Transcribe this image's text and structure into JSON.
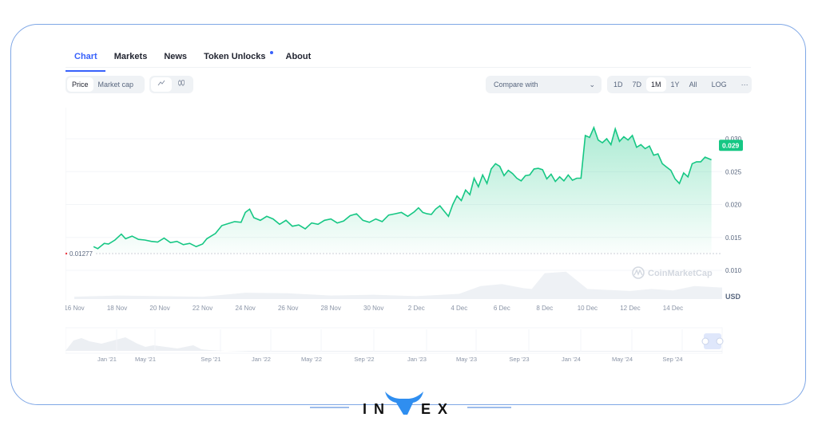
{
  "tabs": [
    {
      "label": "Chart",
      "active": true
    },
    {
      "label": "Markets",
      "active": false
    },
    {
      "label": "News",
      "active": false
    },
    {
      "label": "Token Unlocks",
      "active": false,
      "badge": true
    },
    {
      "label": "About",
      "active": false
    }
  ],
  "toolbar": {
    "price_label": "Price",
    "marketcap_label": "Market cap",
    "line_icon": "line-chart-icon",
    "candle_icon": "candlestick-icon",
    "compare_label": "Compare with",
    "ranges": [
      "1D",
      "7D",
      "1M",
      "1Y",
      "All"
    ],
    "active_range": "1M",
    "log_label": "LOG",
    "more_label": "···"
  },
  "colors": {
    "accent": "#3861fb",
    "line": "#16c784",
    "volume": "#eef1f5",
    "frame": "#7fa7e6"
  },
  "chart_data": {
    "type": "area",
    "title": "",
    "xlabel": "",
    "ylabel": "USD",
    "currency": "USD",
    "current_price_label": "0.029",
    "start_price_label": "0.01277",
    "ylim": [
      0.0085,
      0.0325
    ],
    "y_ticks": [
      "0.030",
      "0.025",
      "0.020",
      "0.015",
      "0.010"
    ],
    "y_tick_values": [
      0.03,
      0.025,
      0.02,
      0.015,
      0.01
    ],
    "x_range_days": [
      0,
      30.3
    ],
    "x_ticks": [
      "16 Nov",
      "18 Nov",
      "20 Nov",
      "22 Nov",
      "24 Nov",
      "26 Nov",
      "28 Nov",
      "30 Nov",
      "2 Dec",
      "4 Dec",
      "6 Dec",
      "8 Dec",
      "10 Dec",
      "12 Dec",
      "14 Dec"
    ],
    "x_tick_days": [
      0,
      2,
      4,
      6,
      8,
      10,
      12,
      14,
      16,
      18,
      20,
      22,
      24,
      26,
      28
    ],
    "watermark": "CoinMarketCap",
    "series": [
      {
        "name": "Price",
        "x_days": [
          0.9,
          1.1,
          1.4,
          1.6,
          1.9,
          2.2,
          2.4,
          2.7,
          3.0,
          3.3,
          3.6,
          3.9,
          4.2,
          4.5,
          4.8,
          5.1,
          5.4,
          5.7,
          6.0,
          6.2,
          6.4,
          6.6,
          6.9,
          7.2,
          7.5,
          7.8,
          8.0,
          8.2,
          8.4,
          8.7,
          9.0,
          9.3,
          9.6,
          9.9,
          10.2,
          10.5,
          10.8,
          11.1,
          11.4,
          11.7,
          12.0,
          12.3,
          12.6,
          12.9,
          13.2,
          13.5,
          13.8,
          14.1,
          14.4,
          14.7,
          15.0,
          15.3,
          15.6,
          15.9,
          16.1,
          16.3,
          16.5,
          16.7,
          16.9,
          17.1,
          17.3,
          17.5,
          17.7,
          17.9,
          18.1,
          18.3,
          18.5,
          18.7,
          18.9,
          19.1,
          19.3,
          19.5,
          19.7,
          19.9,
          20.1,
          20.3,
          20.5,
          20.7,
          20.9,
          21.1,
          21.3,
          21.5,
          21.7,
          21.9,
          22.1,
          22.3,
          22.5,
          22.7,
          22.9,
          23.1,
          23.3,
          23.5,
          23.7,
          23.9,
          24.1,
          24.3,
          24.5,
          24.7,
          24.9,
          25.1,
          25.3,
          25.5,
          25.7,
          25.9,
          26.1,
          26.3,
          26.5,
          26.7,
          26.9,
          27.1,
          27.3,
          27.5,
          27.7,
          27.9,
          28.1,
          28.3,
          28.5,
          28.7,
          28.9,
          29.1,
          29.3,
          29.5,
          29.8
        ],
        "values": [
          0.0136,
          0.0133,
          0.0141,
          0.014,
          0.0146,
          0.0155,
          0.0148,
          0.0152,
          0.0147,
          0.0146,
          0.0144,
          0.0143,
          0.0149,
          0.0142,
          0.0144,
          0.0139,
          0.0141,
          0.0136,
          0.014,
          0.0148,
          0.0152,
          0.0156,
          0.0168,
          0.0171,
          0.0174,
          0.0173,
          0.0188,
          0.0193,
          0.018,
          0.0176,
          0.0182,
          0.0178,
          0.017,
          0.0176,
          0.0167,
          0.0169,
          0.0163,
          0.0172,
          0.017,
          0.0176,
          0.0178,
          0.0172,
          0.0175,
          0.0183,
          0.0186,
          0.0176,
          0.0173,
          0.0178,
          0.0174,
          0.0184,
          0.0186,
          0.0188,
          0.0182,
          0.0189,
          0.0195,
          0.0188,
          0.0186,
          0.0185,
          0.0193,
          0.0198,
          0.019,
          0.0182,
          0.02,
          0.0213,
          0.0206,
          0.0222,
          0.0215,
          0.024,
          0.0227,
          0.0245,
          0.0232,
          0.0254,
          0.0262,
          0.0258,
          0.0244,
          0.0252,
          0.0247,
          0.024,
          0.0236,
          0.0244,
          0.0245,
          0.0254,
          0.0255,
          0.0253,
          0.0239,
          0.0246,
          0.0235,
          0.0242,
          0.0236,
          0.0245,
          0.0237,
          0.024,
          0.024,
          0.0305,
          0.0302,
          0.0317,
          0.0298,
          0.0294,
          0.03,
          0.0291,
          0.0315,
          0.0296,
          0.0303,
          0.0298,
          0.0305,
          0.0287,
          0.0291,
          0.0285,
          0.0289,
          0.0275,
          0.0277,
          0.0262,
          0.0257,
          0.0252,
          0.0239,
          0.0232,
          0.0248,
          0.0242,
          0.0262,
          0.0265,
          0.0265,
          0.0272,
          0.0268,
          0.0264,
          0.0275,
          0.0272,
          0.028,
          0.0277,
          0.0271,
          0.0279,
          0.0276,
          0.0283,
          0.029
        ]
      }
    ],
    "volume": {
      "x_days": [
        0,
        2,
        4,
        6,
        8,
        10,
        12,
        14,
        16,
        18,
        19,
        20,
        21,
        21.4,
        22,
        23,
        24,
        26,
        27,
        28,
        29,
        30.3
      ],
      "values": [
        0.08,
        0.12,
        0.1,
        0.08,
        0.22,
        0.2,
        0.12,
        0.15,
        0.1,
        0.18,
        0.45,
        0.52,
        0.38,
        0.35,
        0.9,
        0.95,
        0.35,
        0.28,
        0.35,
        0.3,
        0.45,
        0.4
      ]
    },
    "navigator": {
      "x_ticks": [
        "Jan '21",
        "May '21",
        "Sep '21",
        "Jan '22",
        "May '22",
        "Sep '22",
        "Jan '23",
        "May '23",
        "Sep '23",
        "Jan '24",
        "May '24",
        "Sep '24"
      ]
    }
  },
  "brand": {
    "name_left": "IN",
    "name_mid": "V",
    "name_right": "EX"
  }
}
